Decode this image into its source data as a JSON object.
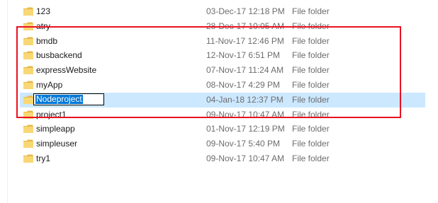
{
  "files": [
    {
      "name": "123",
      "date": "03-Dec-17 12:18 PM",
      "type": "File folder"
    },
    {
      "name": "atry",
      "date": "28-Dec-17 10:05 AM",
      "type": "File folder"
    },
    {
      "name": "bmdb",
      "date": "11-Nov-17 12:46 PM",
      "type": "File folder"
    },
    {
      "name": "busbackend",
      "date": "12-Nov-17 6:51 PM",
      "type": "File folder"
    },
    {
      "name": "expressWebsite",
      "date": "07-Nov-17 11:24 AM",
      "type": "File folder"
    },
    {
      "name": "myApp",
      "date": "08-Nov-17 4:29 PM",
      "type": "File folder"
    },
    {
      "name": "Nodeproject",
      "date": "04-Jan-18 12:37 PM",
      "type": "File folder"
    },
    {
      "name": "project1",
      "date": "09-Nov-17 10:47 AM",
      "type": "File folder"
    },
    {
      "name": "simpleapp",
      "date": "01-Nov-17 12:19 PM",
      "type": "File folder"
    },
    {
      "name": "simpleuser",
      "date": "09-Nov-17 5:40 PM",
      "type": "File folder"
    },
    {
      "name": "try1",
      "date": "09-Nov-17 10:47 AM",
      "type": "File folder"
    }
  ],
  "rename": {
    "value": "Nodeproject"
  },
  "colors": {
    "selection": "#cce8ff",
    "rename_highlight": "#0078d7",
    "annotation_box": "#e81123",
    "folder_icon": "#f8d775"
  }
}
